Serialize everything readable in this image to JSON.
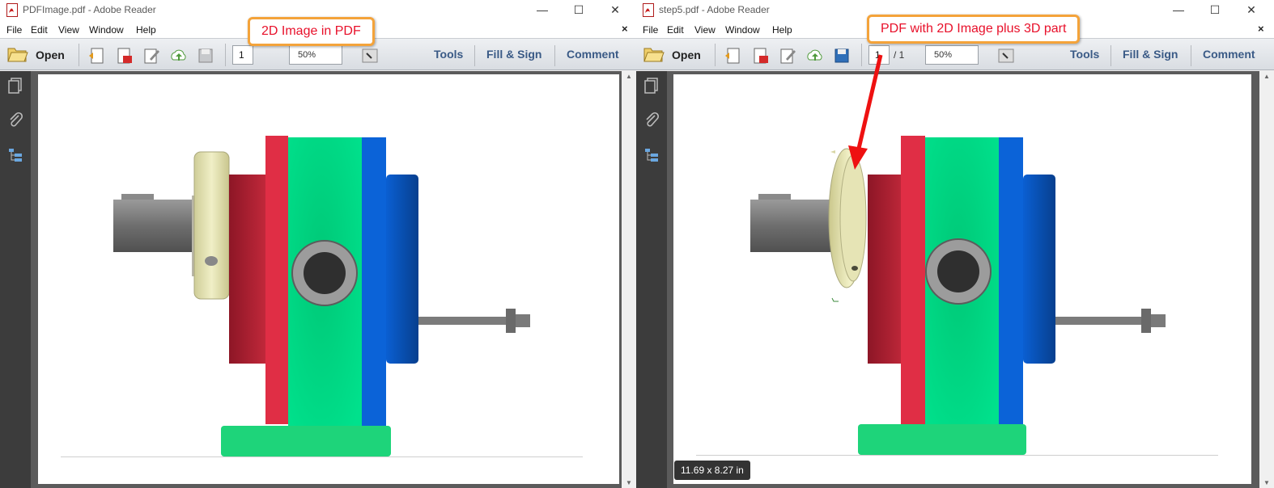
{
  "menu": {
    "file": "File",
    "edit": "Edit",
    "view": "View",
    "window": "Window",
    "help": "Help",
    "close_doc": "×"
  },
  "toolbar": {
    "open_label": "Open",
    "tools_label": "Tools",
    "fill_sign_label": "Fill & Sign",
    "comment_label": "Comment"
  },
  "window_controls": {
    "minimize": "—",
    "maximize": "☐",
    "close": "✕"
  },
  "left_window": {
    "title": "PDFImage.pdf - Adobe Reader",
    "page_number": "1",
    "zoom": "50%",
    "callout": "2D Image in PDF"
  },
  "right_window": {
    "title": "step5.pdf - Adobe Reader",
    "page_number": "1",
    "page_total": "/ 1",
    "zoom": "50%",
    "callout": "PDF with 2D Image plus 3D part",
    "page_size": "11.69 x 8.27 in"
  },
  "colors": {
    "accent_orange": "#f4a33a",
    "callout_text": "#e8102a",
    "pump_red": "#d83344",
    "pump_green": "#00dd88",
    "pump_blue": "#0a5fcc",
    "collar_cream": "#e9e8b8"
  }
}
